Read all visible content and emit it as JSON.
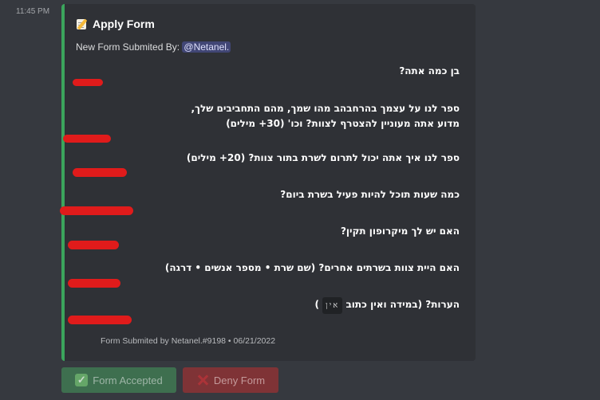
{
  "message": {
    "timestamp": "11:45 PM"
  },
  "embed": {
    "title": "Apply Form",
    "title_icon": "memo-icon",
    "description_prefix": "New Form Submited By:",
    "mention": "@Netanel.",
    "accent_color": "#3ba55c",
    "fields": [
      {
        "question": "בן כמה אתה?"
      },
      {
        "question": "ספר לנו על עצמך בהרחבהב מהו שמך, מהם התחביבים שלך, מדוע אתה מעוניין להצטרף לצוות? וכו' (30+ מילים)"
      },
      {
        "question": "ספר לנו איך אתה יכול לתרום לשרת בתור צוות? (20+ מילים)"
      },
      {
        "question": "כמה שעות תוכל להיות פעיל בשרת ביום?"
      },
      {
        "question": "האם יש לך מיקרופון תקין?"
      },
      {
        "question": "האם היית צוות בשרתים אחרים? (שם שרת • מספר אנשים • דרגה)"
      },
      {
        "question": "הערות? (במידה ואין כתוב",
        "code": "אין",
        "close": ")"
      }
    ],
    "footer": "Form Submited by Netanel.#9198 • 06/21/2022"
  },
  "buttons": {
    "accept": {
      "label": "Form Accepted",
      "icon": "check-icon",
      "color": "#3e6f4f"
    },
    "deny": {
      "label": "Deny Form",
      "icon": "x-icon",
      "color": "#7f3336"
    }
  }
}
